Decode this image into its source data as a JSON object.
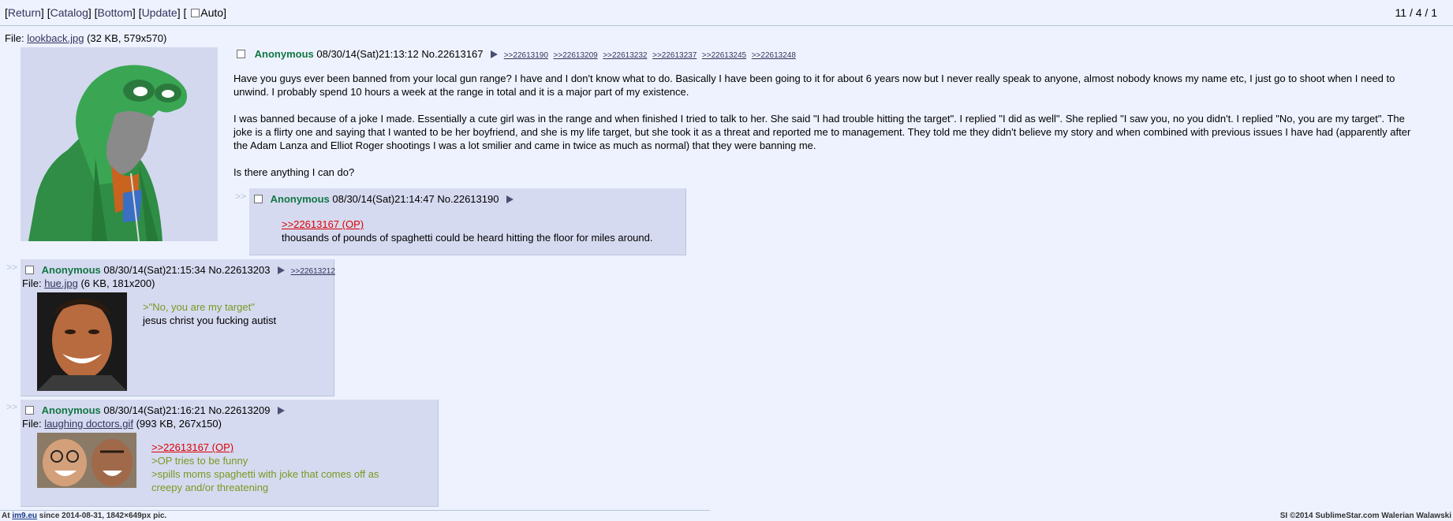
{
  "nav": {
    "return": "Return",
    "catalog": "Catalog",
    "bottom": "Bottom",
    "update": "Update",
    "auto": "Auto",
    "page_count": "11 / 4 / 1"
  },
  "op": {
    "file_label": "File:",
    "file_name": "lookback.jpg",
    "file_meta": "(32 KB, 579x570)",
    "name": "Anonymous",
    "datetime": "08/30/14(Sat)21:13:12",
    "number": "No.22613167",
    "backlinks": [
      ">>22613190",
      ">>22613209",
      ">>22613232",
      ">>22613237",
      ">>22613245",
      ">>22613248"
    ],
    "paragraphs": [
      "Have you guys ever been banned from your local gun range? I have and I don't know what to do. Basically I have been going to it for about 6 years now but I never really speak to anyone, almost nobody knows my name etc, I just go to shoot when I need to unwind. I probably spend 10 hours a week at the range in total and it is a major part of my existence.",
      "I was banned because of a joke I made. Essentially a cute girl was in the range and when finished I tried to talk to her. She said \"I had trouble hitting the target\". I replied \"I did as well\". She replied \"I saw you, no you didn't. I replied \"No, you are my target\". The joke is a flirty one and saying that I wanted to be her boyfriend, and she is my life target, but she took it as a threat and reported me to management. They told me they didn't believe my story and when combined with previous issues I have had (apparently after the Adam Lanza and Elliot Roger shootings I was a lot smilier and came in twice as much as normal) that they were banning me.",
      "Is there anything I can do?"
    ]
  },
  "replies": [
    {
      "arrows": ">>",
      "name": "Anonymous",
      "datetime": "08/30/14(Sat)21:14:47",
      "number": "No.22613190",
      "quote": ">>22613167 (OP)",
      "text": "thousands of pounds of spaghetti could be heard hitting the floor for miles around."
    },
    {
      "arrows": ">>",
      "name": "Anonymous",
      "datetime": "08/30/14(Sat)21:15:34",
      "number": "No.22613203",
      "backlink": ">>22613212",
      "file_label": "File:",
      "file_name": "hue.jpg",
      "file_meta": "(6 KB, 181x200)",
      "green": ">\"No, you are my target\"",
      "text": "jesus christ you fucking autist"
    },
    {
      "arrows": ">>",
      "name": "Anonymous",
      "datetime": "08/30/14(Sat)21:16:21",
      "number": "No.22613209",
      "file_label": "File:",
      "file_name": "laughing doctors.gif",
      "file_meta": "(993 KB, 267x150)",
      "quote": ">>22613167 (OP)",
      "green1": ">OP tries to be funny",
      "green2": ">spills moms spaghetti with joke that comes off as",
      "green3": "creepy and/or threatening"
    }
  ],
  "footer": {
    "left_prefix": "At ",
    "left_link": "im9.eu",
    "left_suffix": " since 2014-08-31, 1842×649px pic.",
    "right": "SI ©2014 SublimeStar.com Walerian Walawski"
  },
  "colors": {
    "background": "#eef2ff",
    "reply_bg": "#d6daf0",
    "name": "#117743",
    "quotelink": "#dd0000",
    "greentext": "#789922"
  }
}
